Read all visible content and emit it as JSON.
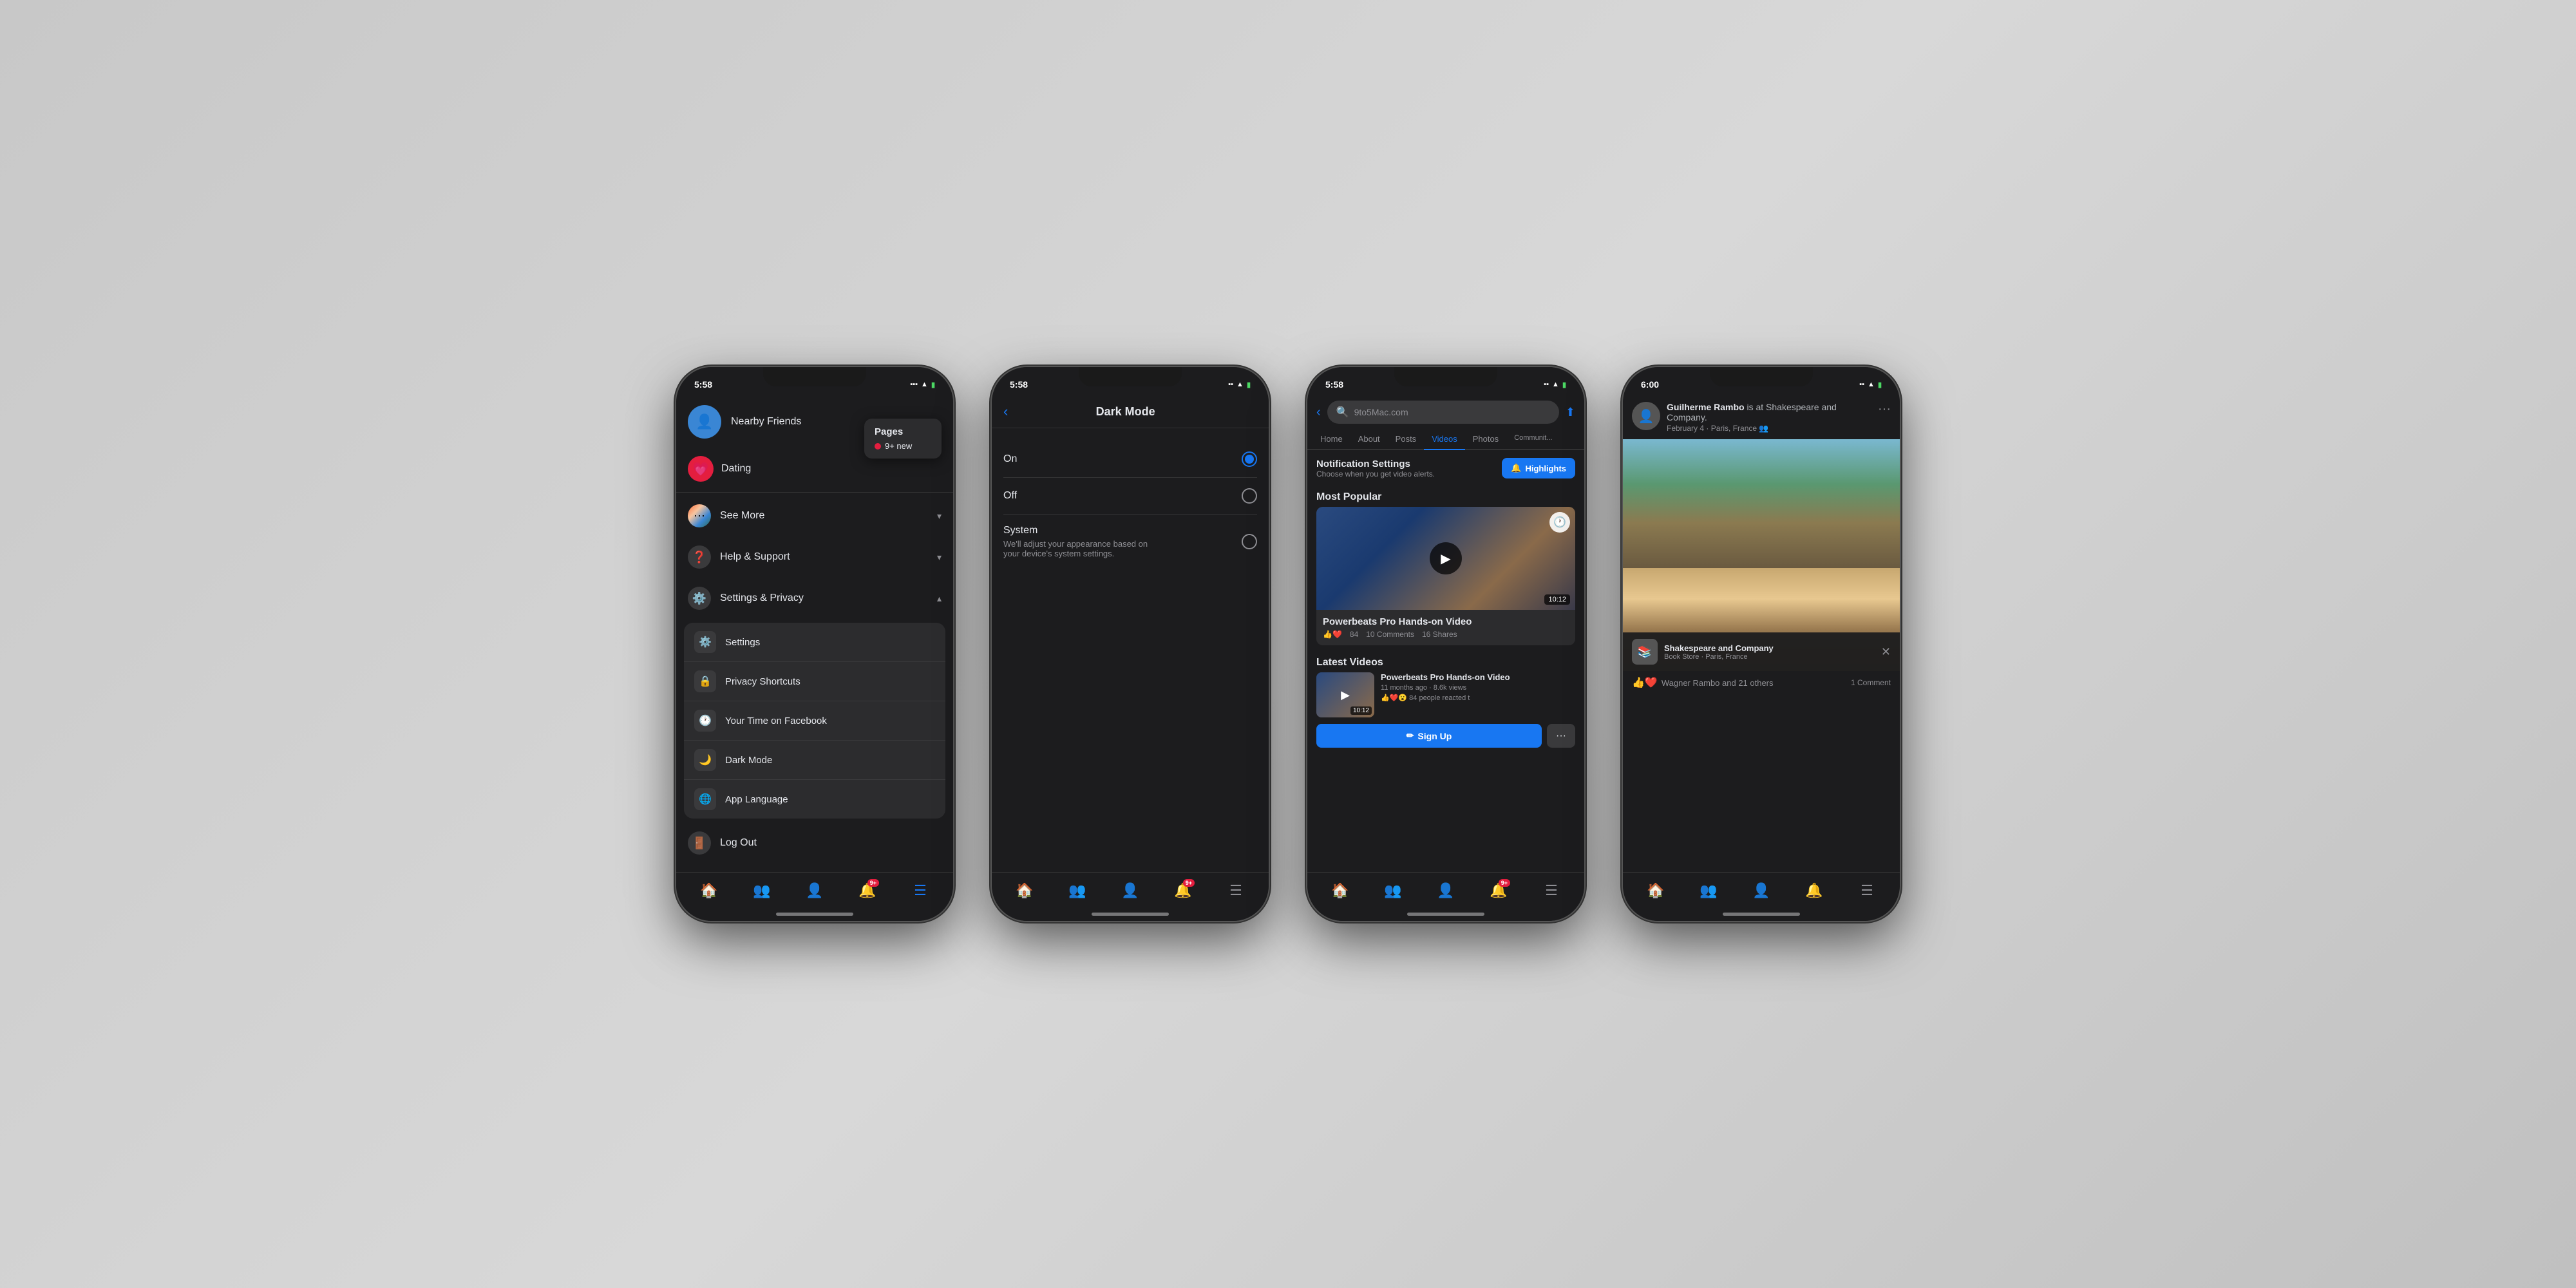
{
  "phones": [
    {
      "id": "phone1",
      "time": "5:58",
      "screen": "menu",
      "nearby_friends": {
        "label": "Nearby Friends"
      },
      "pages_dropdown": {
        "title": "Pages",
        "badge": "9+ new"
      },
      "dating": {
        "label": "Dating"
      },
      "see_more": {
        "label": "See More"
      },
      "help_support": {
        "label": "Help & Support"
      },
      "settings_privacy": {
        "label": "Settings & Privacy",
        "expanded": true,
        "items": [
          {
            "label": "Settings",
            "icon": "⚙️"
          },
          {
            "label": "Privacy Shortcuts",
            "icon": "🔒"
          },
          {
            "label": "Your Time on Facebook",
            "icon": "🕐"
          },
          {
            "label": "Dark Mode",
            "icon": "🌙"
          },
          {
            "label": "App Language",
            "icon": "🌐"
          }
        ]
      },
      "log_out": "Log Out",
      "nav_items": [
        {
          "icon": "🏠",
          "active": false
        },
        {
          "icon": "👥",
          "active": false
        },
        {
          "icon": "👤",
          "active": false
        },
        {
          "icon": "🔔",
          "active": false,
          "badge": "9+"
        },
        {
          "icon": "☰",
          "active": true
        }
      ]
    },
    {
      "id": "phone2",
      "time": "5:58",
      "screen": "dark_mode",
      "title": "Dark Mode",
      "options": [
        {
          "label": "On",
          "desc": "",
          "selected": true
        },
        {
          "label": "Off",
          "desc": "",
          "selected": false
        },
        {
          "label": "System",
          "desc": "We'll adjust your appearance based on your device's system settings.",
          "selected": false
        }
      ],
      "nav_items": [
        {
          "icon": "🏠",
          "active": false
        },
        {
          "icon": "👥",
          "active": false
        },
        {
          "icon": "👤",
          "active": false
        },
        {
          "icon": "🔔",
          "active": false,
          "badge": "9+"
        },
        {
          "icon": "☰",
          "active": false
        }
      ]
    },
    {
      "id": "phone3",
      "time": "5:58",
      "screen": "videos",
      "search_text": "9to5Mac.com",
      "tabs": [
        "Home",
        "About",
        "Posts",
        "Videos",
        "Photos",
        "Communit..."
      ],
      "active_tab": "Videos",
      "notification_settings": {
        "title": "Notification Settings",
        "subtitle": "Choose when you get video alerts.",
        "highlights_btn": "Highlights"
      },
      "most_popular": {
        "section_title": "Most Popular",
        "video": {
          "title": "Powerbeats Pro Hands-on Video",
          "reactions": "84",
          "comments": "10 Comments",
          "shares": "16 Shares",
          "duration": "10:12"
        }
      },
      "latest_videos": {
        "section_title": "Latest Videos",
        "video": {
          "title": "Powerbeats Pro Hands-on Video",
          "meta1": "11 months ago · 8.6k views",
          "meta2": "84 people reacted t",
          "duration": "10:12"
        }
      },
      "sign_up_btn": "Sign Up",
      "nav_items": [
        {
          "icon": "🏠",
          "active": true
        },
        {
          "icon": "👥",
          "active": false
        },
        {
          "icon": "👤",
          "active": false
        },
        {
          "icon": "🔔",
          "active": false,
          "badge": "9+"
        },
        {
          "icon": "☰",
          "active": false
        }
      ]
    },
    {
      "id": "phone4",
      "time": "6:00",
      "screen": "post",
      "post": {
        "author": "Guilherme Rambo",
        "location": "is at Shakespeare and Company.",
        "date": "February 4 · Paris, France",
        "page_card": {
          "name": "Shakespeare and Company",
          "sub": "Book Store · Paris, France",
          "icon": "📚"
        }
      },
      "reactions": {
        "count": "Wagner Rambo and 21 others",
        "comments": "1 Comment"
      },
      "nav_items": [
        {
          "icon": "🏠",
          "active": false
        },
        {
          "icon": "👥",
          "active": false
        },
        {
          "icon": "👤",
          "active": true
        },
        {
          "icon": "🔔",
          "active": false
        },
        {
          "icon": "☰",
          "active": false
        }
      ]
    }
  ]
}
